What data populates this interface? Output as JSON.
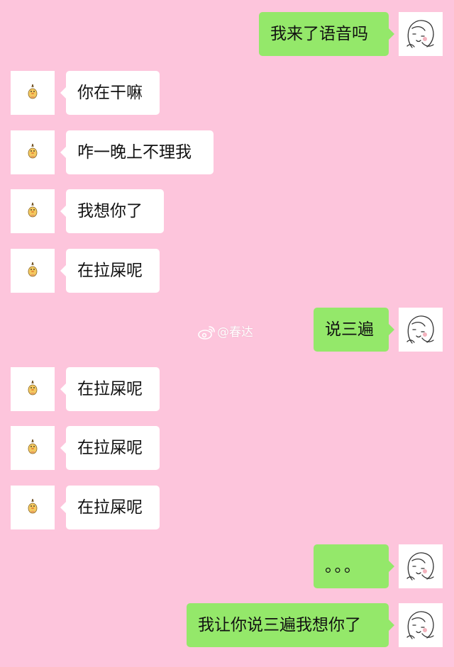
{
  "conversation": {
    "messages": [
      {
        "side": "right",
        "text": "我来了语音吗"
      },
      {
        "side": "left",
        "text": "你在干嘛"
      },
      {
        "side": "left",
        "text": "咋一晚上不理我"
      },
      {
        "side": "left",
        "text": "我想你了"
      },
      {
        "side": "left",
        "text": "在拉屎呢"
      },
      {
        "side": "right",
        "text": "说三遍"
      },
      {
        "side": "left",
        "text": "在拉屎呢"
      },
      {
        "side": "left",
        "text": "在拉屎呢"
      },
      {
        "side": "left",
        "text": "在拉屎呢"
      },
      {
        "side": "right",
        "text": "。。。"
      },
      {
        "side": "right",
        "text": "我让你说三遍我想你了"
      }
    ]
  },
  "watermark": {
    "handle": "@春达",
    "icon": "weibo-logo-icon"
  },
  "colors": {
    "background": "#fdc5dc",
    "sent_bubble": "#94e86a",
    "received_bubble": "#ffffff"
  },
  "avatars": {
    "left": "duck-avatar-icon",
    "right": "sketch-face-avatar-icon"
  }
}
